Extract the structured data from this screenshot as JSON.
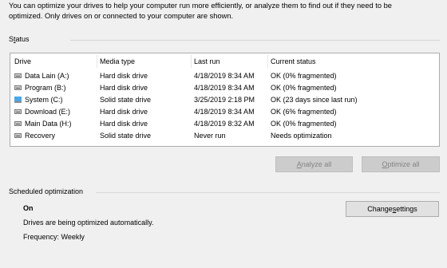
{
  "intro": {
    "line1": "You can optimize your drives to help your computer run more efficiently, or analyze them to find out if they need to be",
    "line2": "optimized. Only drives on or connected to your computer are shown."
  },
  "status_section": {
    "label_prefix": "S",
    "label_accel": "t",
    "label_rest": "atus"
  },
  "drive_list": {
    "columns": [
      "Drive",
      "Media type",
      "Last run",
      "Current status"
    ],
    "rows": [
      {
        "icon": "hard-drive-icon",
        "drive": "Data Lain (A:)",
        "media": "Hard disk drive",
        "last_run": "4/18/2019 8:34 AM",
        "status": "OK (0% fragmented)"
      },
      {
        "icon": "hard-drive-icon",
        "drive": "Program (B:)",
        "media": "Hard disk drive",
        "last_run": "4/18/2019 8:34 AM",
        "status": "OK (0% fragmented)"
      },
      {
        "icon": "system-drive-icon",
        "drive": "System (C:)",
        "media": "Solid state drive",
        "last_run": "3/25/2019 2:18 PM",
        "status": "OK (23 days since last run)"
      },
      {
        "icon": "hard-drive-icon",
        "drive": "Download (E:)",
        "media": "Hard disk drive",
        "last_run": "4/18/2019 8:34 AM",
        "status": "OK (6% fragmented)"
      },
      {
        "icon": "hard-drive-icon",
        "drive": "Main Data (H:)",
        "media": "Hard disk drive",
        "last_run": "4/18/2019 8:32 AM",
        "status": "OK (0% fragmented)"
      },
      {
        "icon": "hard-drive-icon",
        "drive": "Recovery",
        "media": "Solid state drive",
        "last_run": "Never run",
        "status": "Needs optimization"
      }
    ]
  },
  "buttons": {
    "analyze_accel": "A",
    "analyze_rest": "nalyze all",
    "optimize_accel": "O",
    "optimize_rest": "ptimize all",
    "change_pre": "Change ",
    "change_accel": "s",
    "change_rest": "ettings"
  },
  "scheduled": {
    "label": "Scheduled optimization",
    "state": "On",
    "description": "Drives are being optimized automatically.",
    "frequency": "Frequency: Weekly"
  }
}
